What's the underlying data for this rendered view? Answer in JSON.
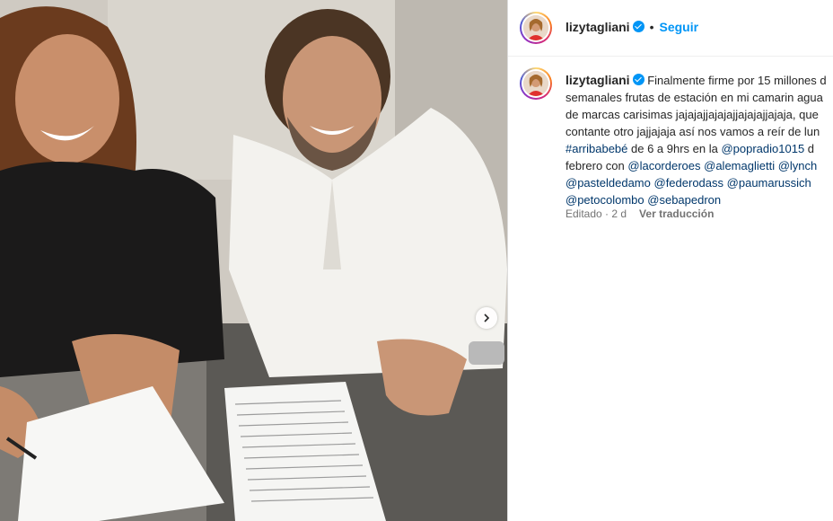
{
  "post": {
    "username": "lizytagliani",
    "follow_label": "Seguir",
    "separator": "•",
    "caption_lines": [
      {
        "parts": [
          {
            "text": "Finalmente firme por 15 millones d"
          }
        ]
      },
      {
        "parts": [
          {
            "text": "semanales frutas de estación en mi camarin agua"
          }
        ]
      },
      {
        "parts": [
          {
            "text": "de marcas carisimas jajajajjajajajjajajajjajaja, que"
          }
        ]
      },
      {
        "parts": [
          {
            "text": "contante otro jajjajaja así nos vamos a reír de lun"
          }
        ]
      },
      {
        "parts": [
          {
            "text": "#arribabebé",
            "link": true
          },
          {
            "text": " de 6 a 9hrs en la "
          },
          {
            "text": "@popradio1015",
            "link": true
          },
          {
            "text": " d"
          }
        ]
      },
      {
        "parts": [
          {
            "text": "febrero con "
          },
          {
            "text": "@lacorderoes",
            "link": true
          },
          {
            "text": " "
          },
          {
            "text": "@alemaglietti",
            "link": true
          },
          {
            "text": " "
          },
          {
            "text": "@lynch",
            "link": true
          }
        ]
      },
      {
        "parts": [
          {
            "text": "@pasteldedamo",
            "link": true
          },
          {
            "text": " "
          },
          {
            "text": "@federodass",
            "link": true
          },
          {
            "text": " "
          },
          {
            "text": "@paumarussich",
            "link": true
          }
        ]
      },
      {
        "parts": [
          {
            "text": "@petocolombo",
            "link": true
          },
          {
            "text": " "
          },
          {
            "text": "@sebapedron",
            "link": true
          }
        ]
      }
    ],
    "edited_label": "Editado · 2 d",
    "translate_label": "Ver traducción"
  },
  "icons": {
    "verified": "verified-badge-icon",
    "carousel_next": "chevron-right-icon"
  },
  "colors": {
    "link": "#00376b",
    "follow": "#0095f6",
    "meta": "#737373"
  }
}
